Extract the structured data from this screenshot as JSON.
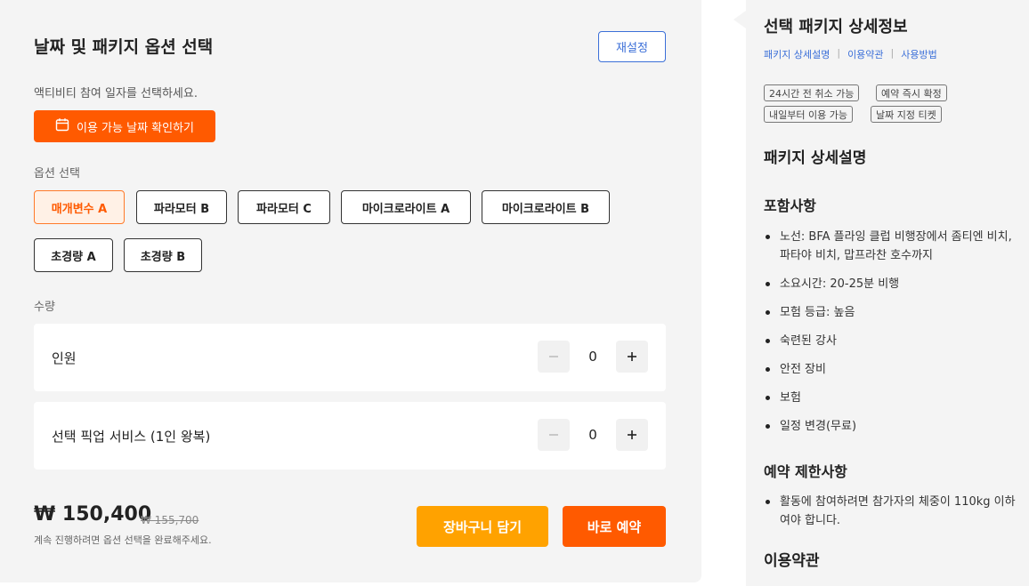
{
  "booking": {
    "title": "날짜 및 패키지 옵션 선택",
    "reset_label": "재설정",
    "date_hint": "액티비티 참여 일자를 선택하세요.",
    "date_button_label": "이용 가능 날짜 확인하기",
    "option_section_label": "옵션 선택",
    "options": [
      {
        "label": "매개변수 A",
        "selected": true
      },
      {
        "label": "파라모터 B",
        "selected": false
      },
      {
        "label": "파라모터 C",
        "selected": false
      },
      {
        "label": "마이크로라이트 A",
        "selected": false
      },
      {
        "label": "마이크로라이트 B",
        "selected": false
      },
      {
        "label": "초경량 A",
        "selected": false
      },
      {
        "label": "초경량 B",
        "selected": false
      }
    ],
    "quantity_section_label": "수량",
    "quantities": [
      {
        "label": "인원",
        "value": "0"
      },
      {
        "label": "선택 픽업 서비스 (1인 왕복)",
        "value": "0"
      }
    ],
    "price": "₩ 150,400",
    "original_price": "₩ 155,700",
    "price_note": "계속 진행하려면 옵션 선택을 완료해주세요.",
    "cart_button_label": "장바구니 담기",
    "buy_button_label": "바로 예약"
  },
  "detail": {
    "title": "선택 패키지 상세정보",
    "links": [
      "패키지 상세설명",
      "이용약관",
      "사용방법"
    ],
    "tags": [
      "24시간 전 취소 가능",
      "예약 즉시 확정",
      "내일부터 이용 가능",
      "날짜 지정 티켓"
    ],
    "package_heading": "패키지 상세설명",
    "includes_heading": "포함사항",
    "includes": [
      "노선: BFA 플라잉 클럽 비행장에서 좀티엔 비치, 파타야 비치, 맙프라찬 호수까지",
      "소요시간: 20-25분 비행",
      "모험 등급: 높음",
      "숙련된 강사",
      "안전 장비",
      "보험",
      "일정 변경(무료)"
    ],
    "restrictions_heading": "예약 제한사항",
    "restrictions": [
      "활동에 참여하려면 참가자의 체중이 110kg 이하여야 합니다."
    ],
    "terms_heading": "이용약관"
  },
  "colors": {
    "primary_orange": "#ff5a00",
    "cart_orange": "#ffa200",
    "link_blue": "#3b6fd8",
    "panel_bg": "#f4f4f4"
  }
}
